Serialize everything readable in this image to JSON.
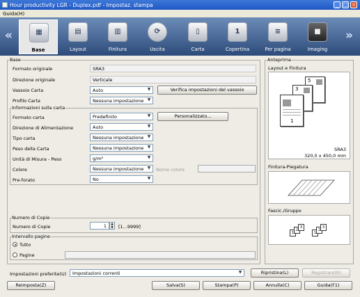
{
  "window": {
    "title": "Hour productivity LGR - Duplex.pdf - Impostaz. stampa",
    "minimize": "_",
    "maximize": "□",
    "close": "×"
  },
  "menu": {
    "help": "Guida(H)"
  },
  "toolbar": {
    "prev_arrow": "«",
    "next_arrow": "»",
    "tabs": [
      {
        "label": "Base",
        "icon": "base-settings-icon",
        "glyph": "▦"
      },
      {
        "label": "Layout",
        "icon": "layout-icon",
        "glyph": "▤"
      },
      {
        "label": "Finitura",
        "icon": "finishing-icon",
        "glyph": "▥"
      },
      {
        "label": "Uscita",
        "icon": "output-icon",
        "glyph": "⟳"
      },
      {
        "label": "Carta",
        "icon": "paper-icon",
        "glyph": "▯"
      },
      {
        "label": "Copertina",
        "icon": "cover-icon",
        "glyph": "1"
      },
      {
        "label": "Per pagina",
        "icon": "per-page-icon",
        "glyph": "≡"
      },
      {
        "label": "Imaging",
        "icon": "imaging-icon",
        "glyph": "■"
      }
    ]
  },
  "base": {
    "legend": "Base",
    "original_size_label": "Formato originale",
    "original_size_value": "SRA3",
    "original_direction_label": "Direzione originale",
    "original_direction_value": "Verticale",
    "paper_tray_label": "Vassoio Carta",
    "paper_tray_value": "Auto",
    "verify_tray_button": "Verifica impostazioni del vassoio",
    "paper_profile_label": "Profilo Carta",
    "paper_profile_value": "Nessuna impostazione"
  },
  "paper_info": {
    "legend": "Informazioni sulla carta",
    "paper_size_label": "Formato carta",
    "paper_size_value": "Predefinito",
    "custom_button": "Personalizzato...",
    "feed_direction_label": "Direzione di Alimentazione",
    "feed_direction_value": "Auto",
    "paper_type_label": "Tipo carta",
    "paper_type_value": "Nessuna impostazione",
    "paper_weight_label": "Peso della Carta",
    "paper_weight_value": "Nessuna impostazione",
    "weight_unit_label": "Unità di Misura - Peso",
    "weight_unit_value": "g/m²",
    "color_label": "Colore",
    "color_value": "Nessuna impostazione",
    "color_name_label": "Nome colore",
    "color_name_value": "",
    "prepunched_label": "Pre-forato",
    "prepunched_value": "No"
  },
  "copies": {
    "legend": "Numero di Copie",
    "label": "Numero di Copie",
    "value": "1",
    "range": "[1...9999]"
  },
  "page_range": {
    "legend": "Intervallo pagine",
    "all_label": "Tutto",
    "pages_label": "Pagine",
    "pages_value": "",
    "selected": "Tutto"
  },
  "favorites": {
    "label": "Impostazioni preferite(U)",
    "value": "Impostazioni correnti",
    "restore_button": "Ripristina(L)",
    "register_button": "Registrare(R)"
  },
  "footer": {
    "reset_button": "Reimposta(Z)",
    "save_button": "Salva(S)",
    "print_button": "Stampa(P)",
    "cancel_button": "Annulla(C)",
    "help_button": "Guida(F1)"
  },
  "preview": {
    "legend": "Anteprima",
    "layout_title": "Layout e Finitura",
    "paper_size": "SRA3",
    "paper_dims": "320,0 x 450,0 mm",
    "pages": [
      "5",
      "3",
      "1"
    ],
    "fold_title": "Finitura-Piegatura",
    "group_title": "Fascic./Gruppo",
    "group_pages_left": [
      "1",
      "2",
      "3"
    ],
    "group_pages_right": [
      "1",
      "2",
      "3"
    ]
  }
}
